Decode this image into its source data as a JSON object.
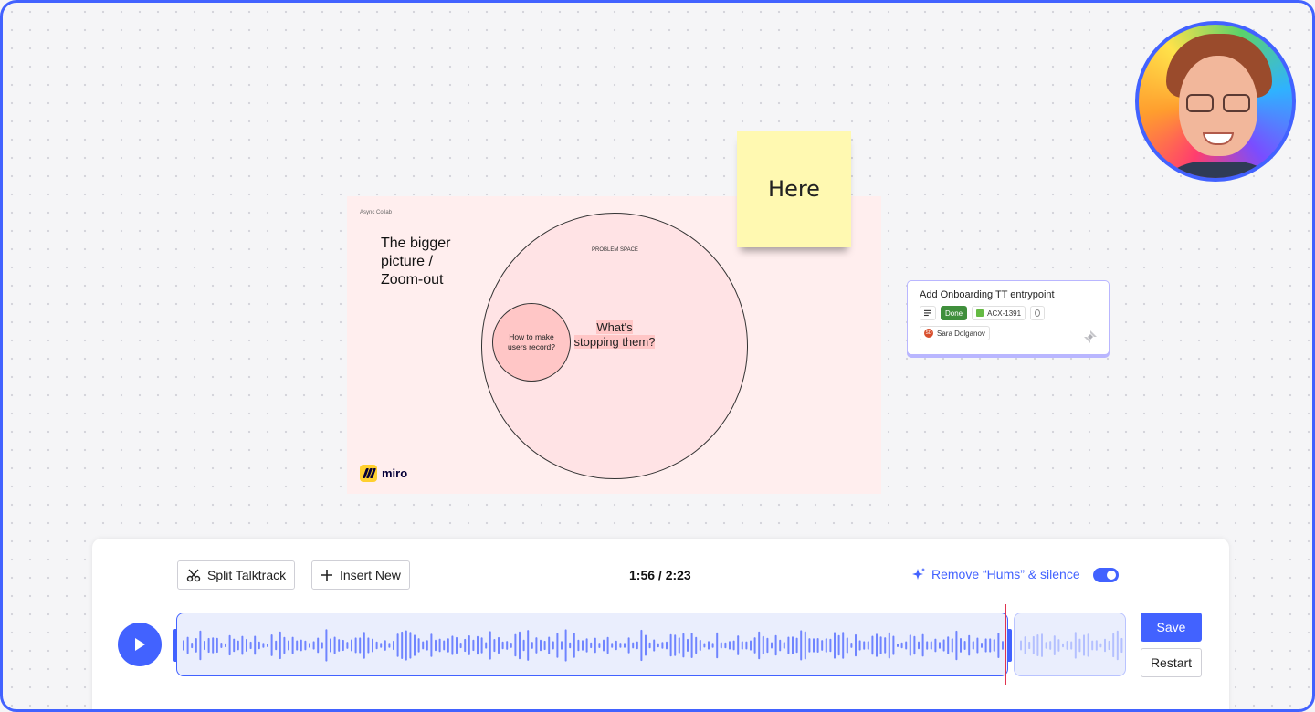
{
  "canvas": {
    "slide": {
      "label": "Async Collab",
      "title": "The bigger\npicture /\nZoom-out",
      "problem_label": "PROBLEM SPACE",
      "small_circle_text": "How to make users record?",
      "center_text": "What's stopping them?",
      "logo_text": "miro"
    },
    "sticky": {
      "text": "Here",
      "color": "#fff9b1"
    },
    "card": {
      "title": "Add Onboarding TT entrypoint",
      "status": "Done",
      "issue_key": "ACX-1391",
      "assignee_initials": "SD",
      "assignee": "Sara Dolganov"
    }
  },
  "toolbar": {
    "split_label": "Split Talktrack",
    "insert_label": "Insert New",
    "time": "1:56 / 2:23",
    "remove_hums_label": "Remove “Hums” & silence",
    "remove_hums_enabled": true,
    "save_label": "Save",
    "restart_label": "Restart"
  },
  "playback": {
    "progress": 0.81,
    "playing": false
  },
  "colors": {
    "accent": "#4262ff",
    "playhead": "#e0334f",
    "wave": "#6f84ff",
    "wave_faded": "#b4c0ff"
  },
  "icons": [
    "scissors-icon",
    "plus-icon",
    "sparkle-icon",
    "play-icon",
    "jira-icon"
  ]
}
